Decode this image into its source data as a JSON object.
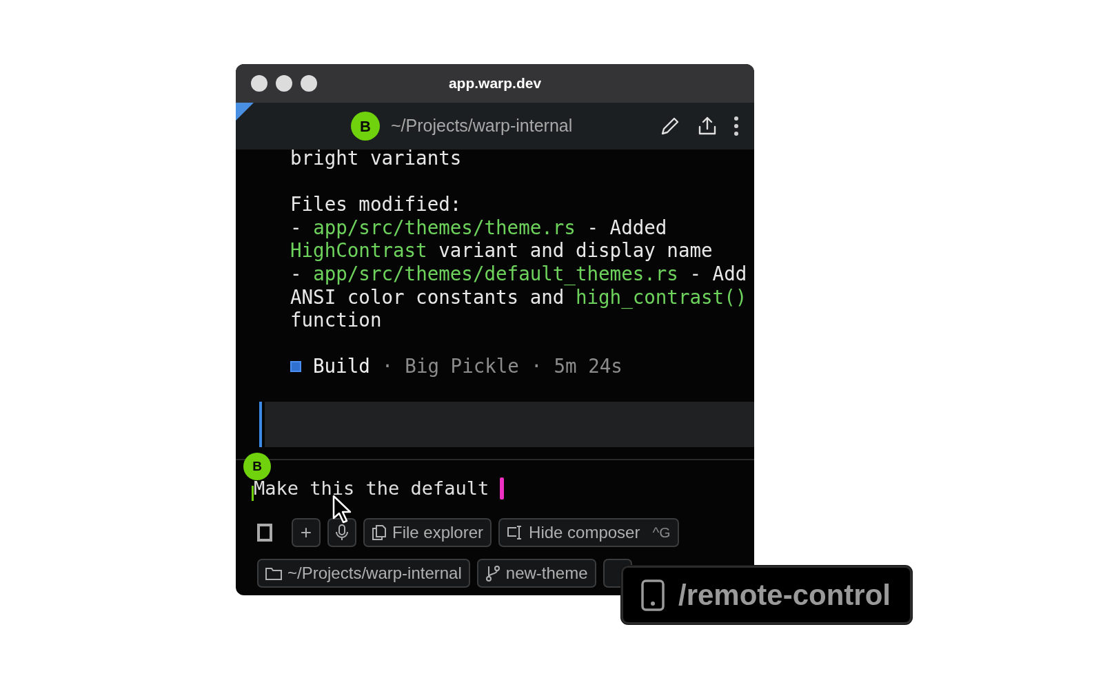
{
  "window": {
    "title": "app.warp.dev"
  },
  "header": {
    "avatar": "B",
    "path": "~/Projects/warp-internal"
  },
  "output": {
    "blocks": [
      {
        "lines": [
          [
            {
              "text": "bright variants",
              "kind": "plain"
            }
          ]
        ]
      },
      {
        "lines": [
          [
            {
              "text": "Files modified:",
              "kind": "plain"
            }
          ],
          [
            {
              "text": "- ",
              "kind": "plain"
            },
            {
              "text": "app/src/themes/theme.rs",
              "kind": "path"
            },
            {
              "text": " - Added",
              "kind": "plain"
            }
          ],
          [
            {
              "text": "HighContrast",
              "kind": "path"
            },
            {
              "text": " variant and display name",
              "kind": "plain"
            }
          ],
          [
            {
              "text": "- ",
              "kind": "plain"
            },
            {
              "text": "app/src/themes/default_themes.rs",
              "kind": "path"
            },
            {
              "text": " - Add",
              "kind": "plain"
            }
          ],
          [
            {
              "text": "ANSI color constants and ",
              "kind": "plain"
            },
            {
              "text": "high_contrast()",
              "kind": "path"
            }
          ],
          [
            {
              "text": "function",
              "kind": "plain"
            }
          ]
        ]
      }
    ],
    "status": [
      {
        "text": "Build",
        "kind": "label"
      },
      {
        "text": "·",
        "kind": "sep"
      },
      {
        "text": "Big Pickle",
        "kind": "meta"
      },
      {
        "text": "·",
        "kind": "sep"
      },
      {
        "text": "5m 24s",
        "kind": "meta"
      }
    ]
  },
  "composer": {
    "avatar": "B",
    "text": "Make this the default"
  },
  "toolbar": [
    {
      "kind": "toggle"
    },
    {
      "kind": "add",
      "label": "+"
    },
    {
      "kind": "mic"
    },
    {
      "kind": "files",
      "label": "File explorer"
    },
    {
      "kind": "hide",
      "label": "Hide composer",
      "shortcut": "^G"
    }
  ],
  "chips": [
    {
      "kind": "folder",
      "label": "~/Projects/warp-internal"
    },
    {
      "kind": "branch",
      "label": "new-theme"
    }
  ],
  "tooltip": {
    "label": "/remote-control"
  }
}
